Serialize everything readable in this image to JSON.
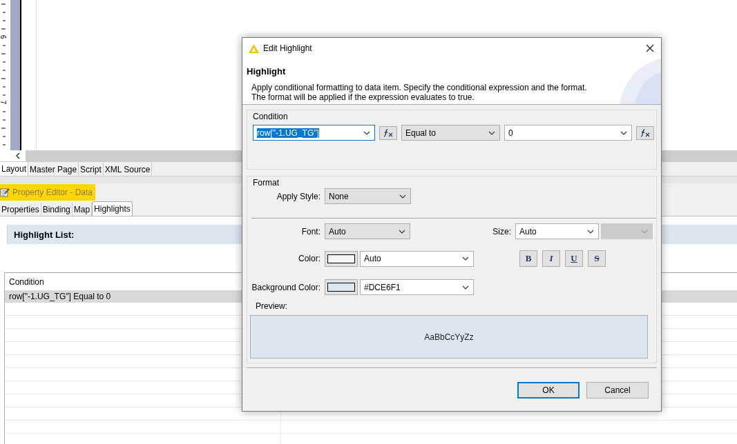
{
  "editor": {
    "ruler_labels": [
      "6",
      "7"
    ],
    "tabs": [
      {
        "label": "Layout",
        "selected": true
      },
      {
        "label": "Master Page",
        "selected": false
      },
      {
        "label": "Script",
        "selected": false
      },
      {
        "label": "XML Source",
        "selected": false
      }
    ]
  },
  "property_editor": {
    "title": "Property Editor - Data",
    "highlighted": true,
    "tabs": [
      {
        "label": "Properties",
        "selected": false
      },
      {
        "label": "Binding",
        "selected": false
      },
      {
        "label": "Map",
        "selected": false
      },
      {
        "label": "Highlights",
        "selected": true
      }
    ],
    "section_title": "Highlight List:",
    "table": {
      "columns": [
        "Condition"
      ],
      "rows": [
        {
          "cells": [
            "row[\"-1.UG_TG\"] Equal to 0"
          ],
          "selected": true
        }
      ]
    }
  },
  "dialog": {
    "title": "Edit Highlight",
    "heading": "Highlight",
    "description": [
      "Apply conditional formatting to data item. Specify the conditional expression and the format.",
      "The format will be applied if the expression evaluates to true."
    ],
    "condition": {
      "legend": "Condition",
      "expression": {
        "value": "row[\"-1.UG_TG\"]",
        "text_selected": true
      },
      "operator": "Equal to",
      "value": "0"
    },
    "format": {
      "legend": "Format",
      "apply_style": {
        "label": "Apply Style:",
        "value": "None"
      },
      "font": {
        "label": "Font:",
        "value": "Auto"
      },
      "size": {
        "label": "Size:",
        "value": "Auto",
        "unit_disabled": true
      },
      "color": {
        "label": "Color:",
        "value": "Auto"
      },
      "background_color": {
        "label": "Background Color:",
        "value": "#DCE6F1"
      },
      "style_buttons": [
        {
          "label": "B",
          "kind": "bold"
        },
        {
          "label": "I",
          "kind": "italic"
        },
        {
          "label": "U",
          "kind": "underline"
        },
        {
          "label": "S",
          "kind": "strike"
        }
      ],
      "preview": {
        "label": "Preview:",
        "text": "AaBbCcYyZz"
      }
    },
    "buttons": [
      {
        "label": "OK",
        "default": true
      },
      {
        "label": "Cancel",
        "default": false
      }
    ]
  }
}
